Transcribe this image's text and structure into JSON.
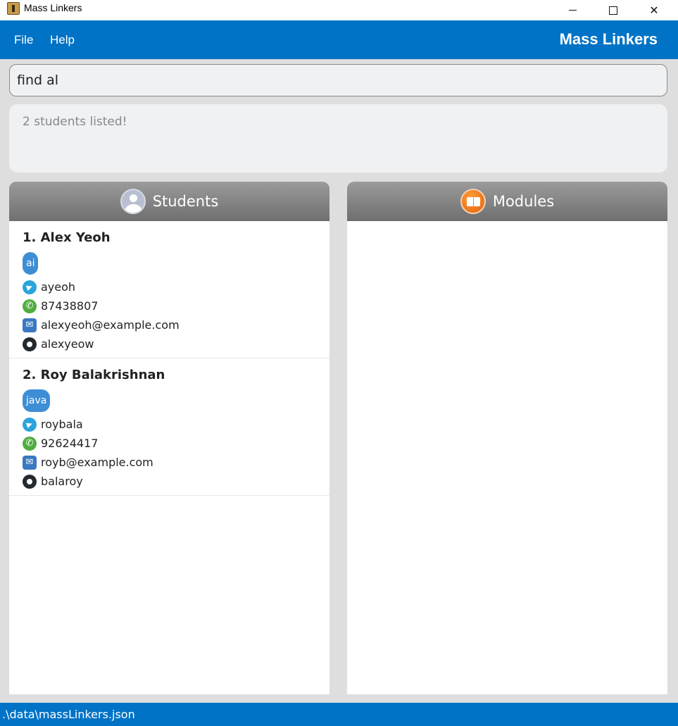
{
  "window": {
    "title": "Mass Linkers",
    "minimize": "",
    "maximize": "",
    "close": "✕"
  },
  "menu": {
    "file": "File",
    "help": "Help",
    "brand": "Mass Linkers"
  },
  "command": {
    "value": "find al"
  },
  "result": {
    "text": "2 students listed!"
  },
  "students_panel": {
    "title": "Students",
    "students": [
      {
        "name": "1. Alex Yeoh",
        "tag": "ai",
        "telegram": "ayeoh",
        "phone": "87438807",
        "email": "alexyeoh@example.com",
        "github": "alexyeow"
      },
      {
        "name": "2. Roy Balakrishnan",
        "tag": "java",
        "telegram": "roybala",
        "phone": "92624417",
        "email": "royb@example.com",
        "github": "balaroy"
      }
    ]
  },
  "modules_panel": {
    "title": "Modules"
  },
  "status": {
    "path": ".\\data\\massLinkers.json"
  },
  "colors": {
    "accent": "#0073c6",
    "tag": "#3e8ed6"
  }
}
